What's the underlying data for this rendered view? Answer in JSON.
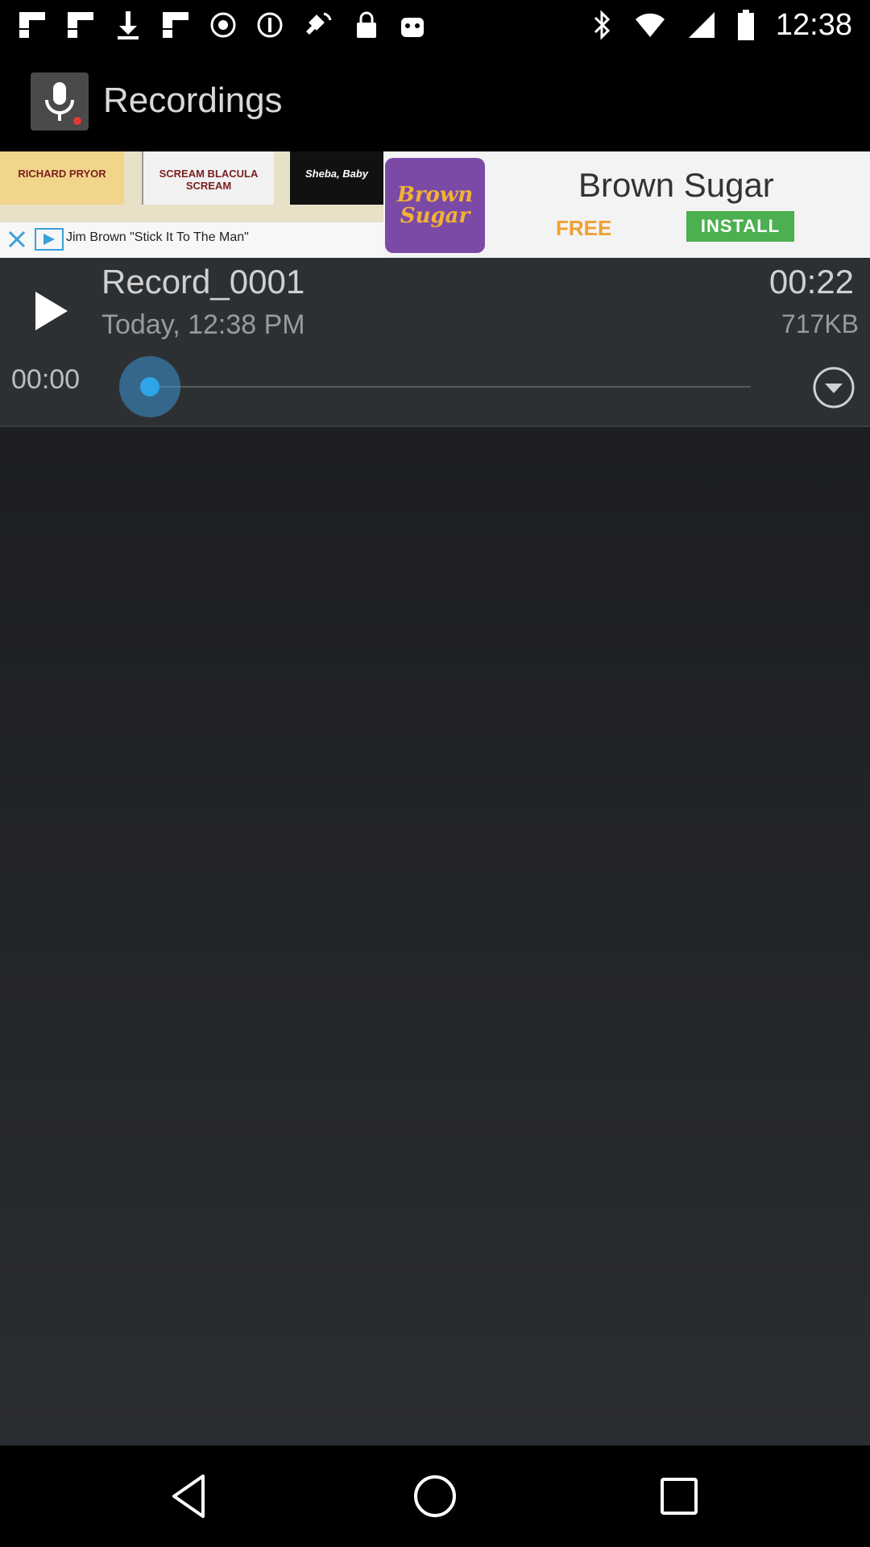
{
  "status_bar": {
    "time": "12:38",
    "left_icons": [
      "flipboard-icon",
      "flipboard-icon",
      "download-icon",
      "flipboard-icon",
      "record-icon",
      "info-icon",
      "fake-gps-icon",
      "lock-icon",
      "android-icon"
    ],
    "right_icons": [
      "bluetooth-icon",
      "wifi-icon",
      "signal-icon",
      "battery-icon"
    ]
  },
  "app_bar": {
    "title": "Recordings",
    "icon": "microphone-icon"
  },
  "ad": {
    "poster_texts": [
      "RICHARD PRYOR",
      "SCREAM BLACULA SCREAM",
      "Sheba, Baby"
    ],
    "caption": "Jim Brown \"Stick It To The Man\"",
    "logo_text": "Brown Sugar",
    "title": "Brown Sugar",
    "free_label": "FREE",
    "install_label": "INSTALL",
    "colors": {
      "install_bg": "#4caf50",
      "free": "#f0a030",
      "logo_bg": "#7b4aa6"
    }
  },
  "recording": {
    "name": "Record_0001",
    "date": "Today, 12:38 PM",
    "duration": "00:22",
    "size": "717KB",
    "current_time": "00:00",
    "progress": 0.0,
    "accent": "#2fa4e7"
  },
  "nav": {
    "buttons": [
      "back-icon",
      "home-icon",
      "recents-icon"
    ]
  }
}
